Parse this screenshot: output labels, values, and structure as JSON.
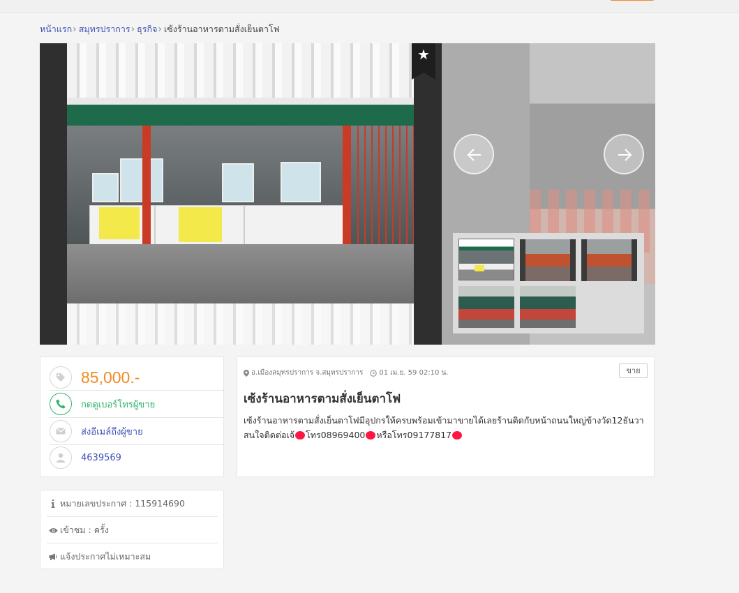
{
  "breadcrumb": {
    "items": [
      "หน้าแรก",
      "สมุทรปราการ",
      "ธุรกิจ"
    ],
    "current": "เซ้งร้านอาหารตามสั่งเย็นตาโฟ"
  },
  "gallery": {
    "favorite_icon": "star-icon",
    "prev_icon": "arrow-left-icon",
    "next_icon": "arrow-right-icon",
    "thumbnail_count": 5,
    "active_thumbnail": 1
  },
  "listing": {
    "price": "85,000.-",
    "call_label": "กดดูเบอร์โทรผู้ขาย",
    "email_label": "ส่งอีเมล์ถึงผู้ขาย",
    "seller_id": "4639569",
    "location": "อ.เมืองสมุทรปราการ จ.สมุทรปราการ",
    "datetime": "01 เม.ย. 59 02:10 น.",
    "type_badge": "ขาย",
    "title": "เซ้งร้านอาหารตามสั่งเย็นตาโฟ",
    "description_part1": "เซ้งร้านอาหารตามสั่งเย็นตาโฟมีอุปกรให้ครบพร้อมเข้ามาขายได้เลยร้านติดกับหน้าถนนใหญ่ข้างวัด12ธันวา สนใจติดต่อเจ้",
    "description_part2": "โทร08969400",
    "description_part3": "หรือโทร09177817"
  },
  "info": {
    "ad_number_label": "หมายเลขประกาศ : 115914690",
    "views_label": "เข้าชม : ครั้ง",
    "report_label": "แจ้งประกาศไม่เหมาะสม"
  },
  "colors": {
    "accent_orange": "#f08a24",
    "link_blue": "#3f51b5",
    "call_green": "#2fb36b",
    "redaction_red": "#ff1744"
  }
}
